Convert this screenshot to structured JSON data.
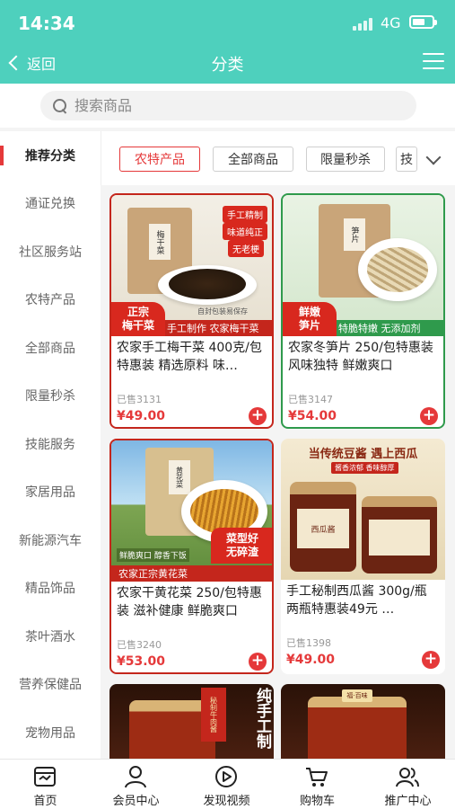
{
  "status_bar": {
    "time": "14:34",
    "network": "4G"
  },
  "navbar": {
    "back_label": "返回",
    "title": "分类"
  },
  "search": {
    "placeholder": "搜索商品"
  },
  "sidebar": {
    "items": [
      {
        "label": "推荐分类",
        "active": true
      },
      {
        "label": "通证兑换"
      },
      {
        "label": "社区服务站"
      },
      {
        "label": "农特产品"
      },
      {
        "label": "全部商品"
      },
      {
        "label": "限量秒杀"
      },
      {
        "label": "技能服务"
      },
      {
        "label": "家居用品"
      },
      {
        "label": "新能源汽车"
      },
      {
        "label": "精品饰品"
      },
      {
        "label": "茶叶酒水"
      },
      {
        "label": "营养保健品"
      },
      {
        "label": "宠物用品"
      }
    ]
  },
  "filters": {
    "chips": [
      {
        "label": "农特产品",
        "active": true
      },
      {
        "label": "全部商品"
      },
      {
        "label": "限量秒杀"
      },
      {
        "label": "技"
      }
    ]
  },
  "products": [
    {
      "name": "农家手工梅干菜 400克/包特惠装 精选原料 味…",
      "sold": "已售3131",
      "price": "¥49.00",
      "image": {
        "bag_label": "梅干菜",
        "tags": [
          "手工精制",
          "味道纯正",
          "无老梗"
        ],
        "badge_line1": "正宗",
        "badge_line2": "梅干菜",
        "small_caption": "自封包装易保存",
        "strip": "手工制作 农家梅干菜"
      }
    },
    {
      "name": "农家冬笋片 250/包特惠装 风味独特 鲜嫩爽口",
      "sold": "已售3147",
      "price": "¥54.00",
      "image": {
        "bag_label": "笋片",
        "badge_line1": "鲜嫩",
        "badge_line2": "笋片",
        "strip": "特脆特嫩 无添加剂"
      }
    },
    {
      "name": "农家干黄花菜 250/包特惠装 滋补健康 鲜脆爽口",
      "sold": "已售3240",
      "price": "¥53.00",
      "image": {
        "bag_label": "黄花菜",
        "caption": "鲜脆爽口 醇香下饭",
        "badge_line1": "菜型好",
        "badge_line2": "无碎渣",
        "strip": "农家正宗黄花菜"
      }
    },
    {
      "name": "手工秘制西瓜酱 300g/瓶 两瓶特惠装49元 …",
      "sold": "已售1398",
      "price": "¥49.00",
      "image": {
        "headline": "当传统豆酱 遇上西瓜",
        "subline": "酱香浓郁 香味醇厚",
        "jar_label": "西瓜酱"
      }
    },
    {
      "name": "",
      "image": {
        "headline": "纯手工制",
        "jar_label": "秘制牛肉酱"
      }
    },
    {
      "name": "",
      "image": {
        "jar_label": "福·百味"
      }
    }
  ],
  "tabbar": {
    "items": [
      {
        "label": "首页",
        "icon": "home-icon"
      },
      {
        "label": "会员中心",
        "icon": "user-icon"
      },
      {
        "label": "发现视频",
        "icon": "video-play-icon"
      },
      {
        "label": "购物车",
        "icon": "cart-icon"
      },
      {
        "label": "推广中心",
        "icon": "promote-users-icon"
      }
    ]
  },
  "colors": {
    "header": "#4ed0bd",
    "accent_red": "#e5393a"
  }
}
